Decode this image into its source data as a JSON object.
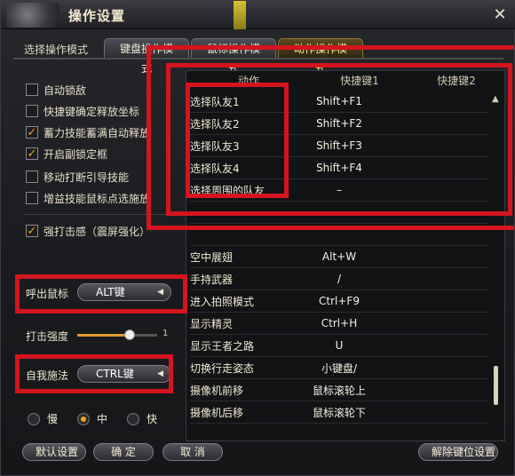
{
  "window": {
    "title": "操作设置",
    "close_glyph": "✕"
  },
  "mode": {
    "label": "选择操作模式",
    "tabs": [
      {
        "label": "键盘操作模式",
        "active": false
      },
      {
        "label": "鼠标操作模式",
        "active": false
      },
      {
        "label": "动作操作模式",
        "active": true
      }
    ]
  },
  "options": [
    {
      "label": "自动锁敌",
      "checked": false
    },
    {
      "label": "快捷键确定释放坐标",
      "checked": false
    },
    {
      "label": "蓄力技能蓄满自动释放",
      "checked": true
    },
    {
      "label": "开启副锁定框",
      "checked": true
    },
    {
      "label": "移动打断引导技能",
      "checked": false
    },
    {
      "label": "增益技能鼠标点选施放",
      "checked": false
    },
    {
      "label": "强打击感（震屏强化）",
      "checked": true
    }
  ],
  "mouse_call": {
    "label": "呼出鼠标",
    "value": "ALT键"
  },
  "hit_strength": {
    "label": "打击强度",
    "value": "1",
    "level": 0.65
  },
  "self_cast": {
    "label": "自我施法",
    "value": "CTRL键"
  },
  "speed": {
    "options": [
      {
        "label": "慢",
        "selected": false
      },
      {
        "label": "中",
        "selected": true
      },
      {
        "label": "快",
        "selected": false
      }
    ]
  },
  "table": {
    "headers": {
      "action": "动作",
      "key1": "快捷键1",
      "key2": "快捷键2"
    },
    "rows": [
      {
        "action": "选择队友1",
        "key1": "Shift+F1",
        "key2": ""
      },
      {
        "action": "选择队友2",
        "key1": "Shift+F2",
        "key2": ""
      },
      {
        "action": "选择队友3",
        "key1": "Shift+F3",
        "key2": ""
      },
      {
        "action": "选择队友4",
        "key1": "Shift+F4",
        "key2": ""
      },
      {
        "action": "选择周围的队友",
        "key1": "–",
        "key2": ""
      },
      {
        "action": "",
        "key1": "",
        "key2": ""
      },
      {
        "action": "",
        "key1": "",
        "key2": ""
      },
      {
        "action": "空中展翅",
        "key1": "Alt+W",
        "key2": ""
      },
      {
        "action": "手持武器",
        "key1": "/",
        "key2": ""
      },
      {
        "action": "进入拍照模式",
        "key1": "Ctrl+F9",
        "key2": ""
      },
      {
        "action": "显示精灵",
        "key1": "Ctrl+H",
        "key2": ""
      },
      {
        "action": "显示王者之路",
        "key1": "U",
        "key2": ""
      },
      {
        "action": "切换行走姿态",
        "key1": "小键盘/",
        "key2": ""
      },
      {
        "action": "摄像机前移",
        "key1": "鼠标滚轮上",
        "key2": ""
      },
      {
        "action": "摄像机后移",
        "key1": "鼠标滚轮下",
        "key2": ""
      }
    ]
  },
  "buttons": {
    "default": "默认设置",
    "ok": "确 定",
    "cancel": "取 消",
    "unbind": "解除键位设置"
  },
  "colors": {
    "highlight_red": "#d4141e",
    "accent_orange": "#f2a21e"
  }
}
